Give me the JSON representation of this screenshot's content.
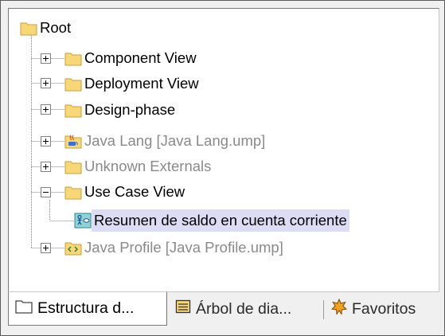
{
  "tree": {
    "root": {
      "label": "Root",
      "icon": "folder-icon"
    },
    "items": [
      {
        "label": "Component View",
        "icon": "folder-icon",
        "state": "collapsed",
        "gray": false
      },
      {
        "label": "Deployment View",
        "icon": "folder-icon",
        "state": "collapsed",
        "gray": false
      },
      {
        "label": "Design-phase",
        "icon": "folder-icon",
        "state": "collapsed",
        "gray": false
      },
      {
        "label": "Java Lang [Java Lang.ump]",
        "icon": "java-package-icon",
        "state": "collapsed",
        "gray": true
      },
      {
        "label": "Unknown Externals",
        "icon": "folder-icon",
        "state": "collapsed",
        "gray": true
      },
      {
        "label": "Use Case View",
        "icon": "folder-icon",
        "state": "expanded",
        "gray": false,
        "children": [
          {
            "label": "Resumen de saldo en cuenta corriente",
            "icon": "use-case-diagram-icon",
            "selected": true
          }
        ]
      },
      {
        "label": "Java Profile [Java Profile.ump]",
        "icon": "profile-package-icon",
        "state": "collapsed",
        "gray": true
      }
    ]
  },
  "tabs": [
    {
      "label": "Estructura d...",
      "icon": "folder-icon",
      "active": true
    },
    {
      "label": "Árbol de dia...",
      "icon": "diagram-tree-icon",
      "active": false
    },
    {
      "label": "Favoritos",
      "icon": "star-icon",
      "active": false
    }
  ],
  "colors": {
    "folder": "#f7d777",
    "selection": "#dcdcf4",
    "gray_text": "#8a8a8a"
  }
}
